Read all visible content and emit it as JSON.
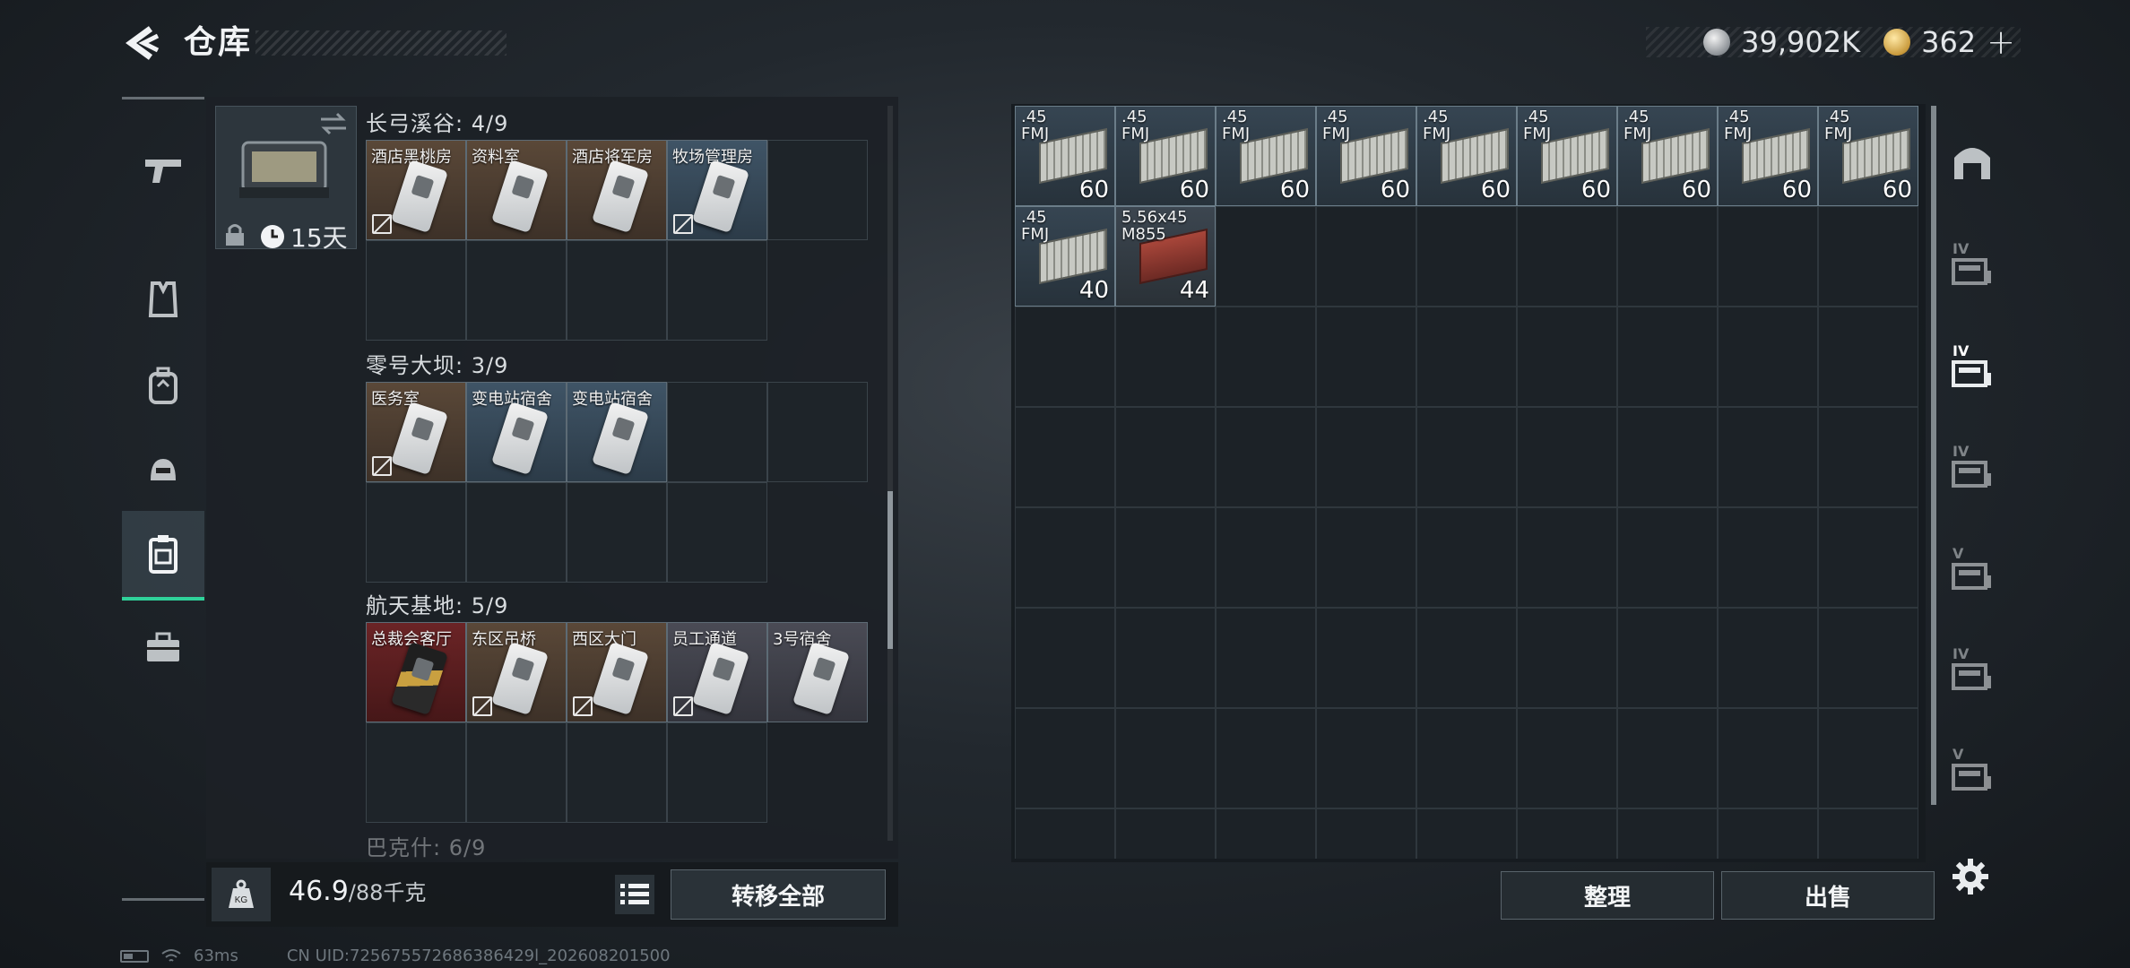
{
  "header": {
    "title": "仓库",
    "currencies": [
      {
        "name": "silver-coin",
        "value": "39,902K"
      },
      {
        "name": "gold-coin",
        "value": "362"
      }
    ],
    "add_label": "+"
  },
  "left_nav": {
    "items": [
      {
        "icon": "gun-icon",
        "active": false
      },
      {
        "icon": "vest-icon",
        "active": false
      },
      {
        "icon": "backpack-icon",
        "active": false
      },
      {
        "icon": "helmet-icon",
        "active": false
      },
      {
        "icon": "keycard-holder-icon",
        "active": true
      },
      {
        "icon": "toolbox-icon",
        "active": false
      }
    ]
  },
  "container": {
    "timer": "15天"
  },
  "key_sections": [
    {
      "label": "长弓溪谷: 4/9",
      "cards": [
        {
          "label": "酒店黑桃房",
          "color": "brown",
          "unusable": true
        },
        {
          "label": "资料室",
          "color": "brown",
          "unusable": false
        },
        {
          "label": "酒店将军房",
          "color": "brown",
          "unusable": false
        },
        {
          "label": "牧场管理房",
          "color": "blue",
          "unusable": true
        }
      ]
    },
    {
      "label": "零号大坝: 3/9",
      "cards": [
        {
          "label": "医务室",
          "color": "brown",
          "unusable": true
        },
        {
          "label": "变电站宿舍",
          "color": "blue",
          "unusable": false
        },
        {
          "label": "变电站宿舍",
          "color": "blue",
          "unusable": false
        }
      ]
    },
    {
      "label": "航天基地: 5/9",
      "cards": [
        {
          "label": "总裁会客厅",
          "color": "red",
          "unusable": false
        },
        {
          "label": "东区吊桥",
          "color": "brown",
          "unusable": true
        },
        {
          "label": "西区大门",
          "color": "brown",
          "unusable": true
        },
        {
          "label": "员工通道",
          "color": "gray",
          "unusable": true
        },
        {
          "label": "3号宿舍",
          "color": "gray",
          "unusable": false
        }
      ]
    },
    {
      "label": "巴克什: 6/9",
      "cards": []
    }
  ],
  "weight": {
    "current": "46.9",
    "max": "/88千克"
  },
  "buttons": {
    "transfer_all": "转移全部",
    "sort": "整理",
    "sell": "出售"
  },
  "stash": {
    "columns": 9,
    "rows": 8,
    "items": [
      {
        "label": ".45\nFMJ",
        "count": "60",
        "type": "ammo"
      },
      {
        "label": ".45\nFMJ",
        "count": "60",
        "type": "ammo"
      },
      {
        "label": ".45\nFMJ",
        "count": "60",
        "type": "ammo"
      },
      {
        "label": ".45\nFMJ",
        "count": "60",
        "type": "ammo"
      },
      {
        "label": ".45\nFMJ",
        "count": "60",
        "type": "ammo"
      },
      {
        "label": ".45\nFMJ",
        "count": "60",
        "type": "ammo"
      },
      {
        "label": ".45\nFMJ",
        "count": "60",
        "type": "ammo"
      },
      {
        "label": ".45\nFMJ",
        "count": "60",
        "type": "ammo"
      },
      {
        "label": ".45\nFMJ",
        "count": "60",
        "type": "ammo"
      },
      {
        "label": ".45\nFMJ",
        "count": "40",
        "type": "ammo"
      },
      {
        "label": "5.56x45\nM855",
        "count": "44",
        "type": "ammo-red"
      }
    ]
  },
  "right_nav": {
    "items": [
      {
        "icon": "safe-icon",
        "tag": "",
        "active": false
      },
      {
        "icon": "stash-folder-icon",
        "tag": "IV",
        "active": false
      },
      {
        "icon": "stash-folder-icon",
        "tag": "IV",
        "active": true
      },
      {
        "icon": "stash-add-icon",
        "tag": "IV",
        "active": false
      },
      {
        "icon": "stash-search-icon",
        "tag": "V",
        "active": false
      },
      {
        "icon": "stash-gear-icon",
        "tag": "IV",
        "active": false
      },
      {
        "icon": "stash-search-icon",
        "tag": "V",
        "active": false
      }
    ]
  },
  "status_bar": {
    "ping": "63ms",
    "uid": "CN UID:725675572686386429l_202608201500"
  }
}
